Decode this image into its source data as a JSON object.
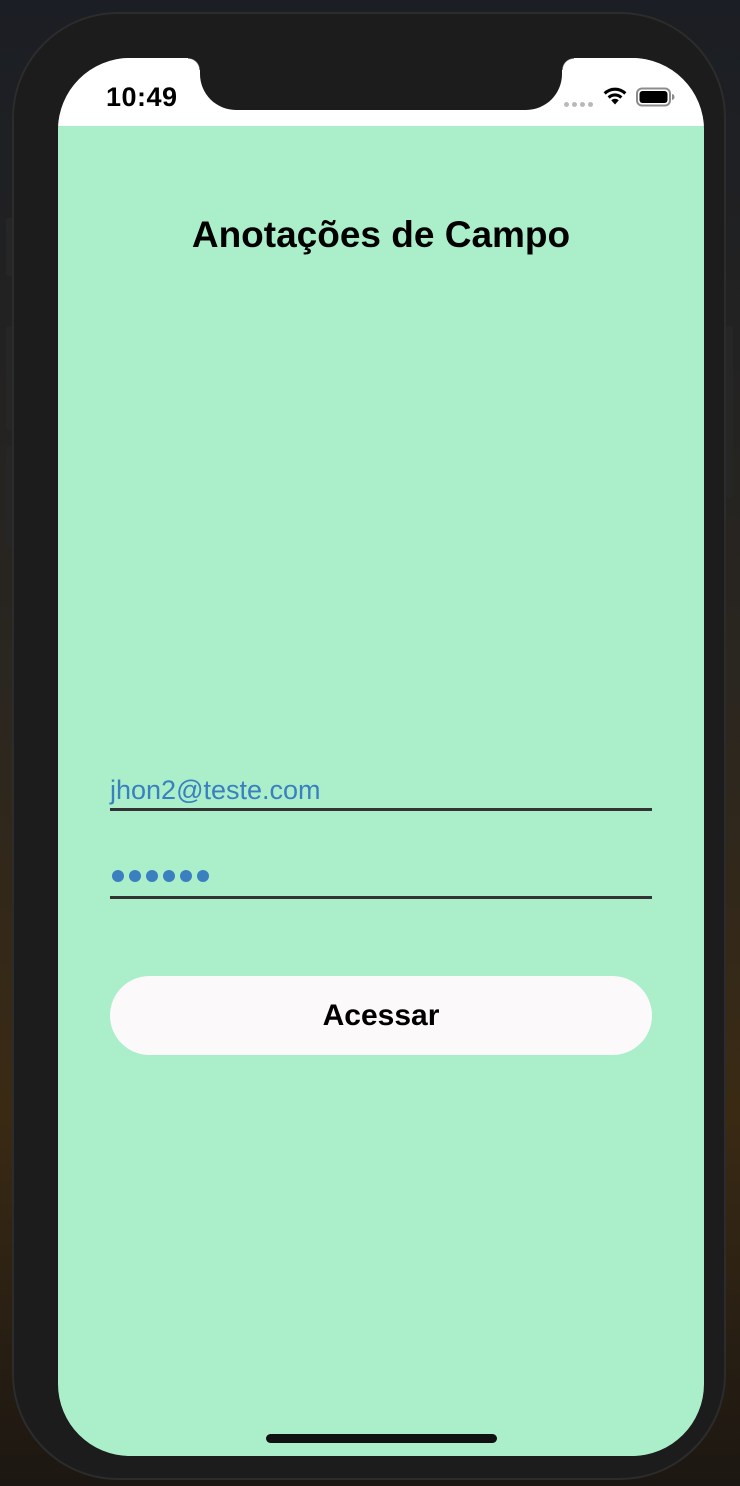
{
  "status_bar": {
    "time": "10:49",
    "signal_icon": "cellular-signal-dots",
    "wifi_icon": "wifi-icon",
    "battery_icon": "battery-full-icon"
  },
  "app": {
    "title": "Anotações de Campo",
    "email_value": "jhon2@teste.com",
    "password_masked_length": 6,
    "submit_label": "Acessar"
  },
  "colors": {
    "background": "#abefca",
    "input_text": "#3a7fbf",
    "button_bg": "#fbf9fa"
  }
}
